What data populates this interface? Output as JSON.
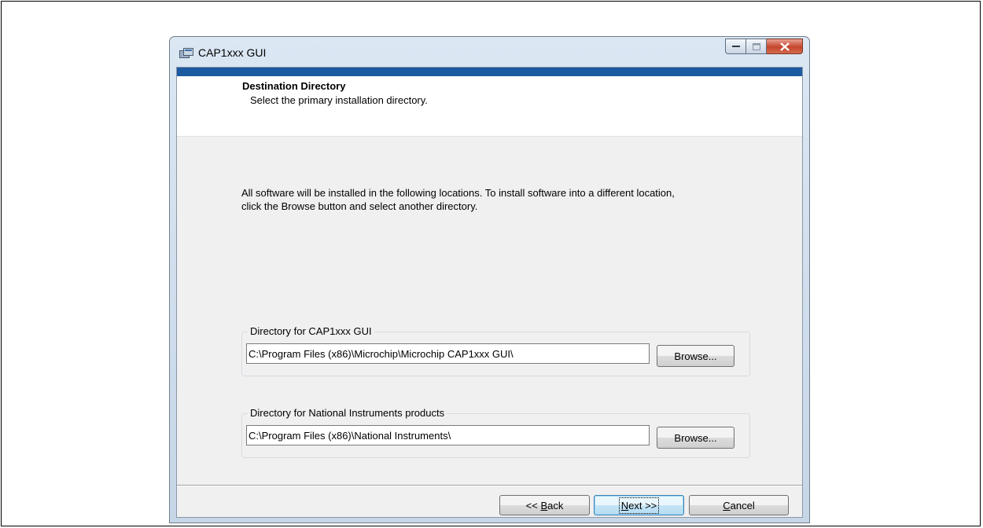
{
  "window": {
    "title": "CAP1xxx GUI",
    "icon": "installer-icon"
  },
  "header": {
    "title": "Destination Directory",
    "subtitle": "Select the primary installation directory."
  },
  "description": "All software will be installed in the following locations. To install software into a different location, click the Browse button and select another directory.",
  "groups": [
    {
      "label": "Directory for CAP1xxx GUI",
      "path": "C:\\Program Files (x86)\\Microchip\\Microchip CAP1xxx GUI\\",
      "browse_label": "Browse..."
    },
    {
      "label": "Directory for National Instruments products",
      "path": "C:\\Program Files (x86)\\National Instruments\\",
      "browse_label": "Browse..."
    }
  ],
  "buttons": {
    "back_prefix": "<< ",
    "back_accel": "B",
    "back_rest": "ack",
    "next_accel": "N",
    "next_rest": "ext >>",
    "cancel_accel": "C",
    "cancel_rest": "ancel"
  },
  "colors": {
    "accent_strip": "#1c5aa0",
    "close_button": "#c6452d",
    "dialog_background": "#f0f0f0"
  }
}
